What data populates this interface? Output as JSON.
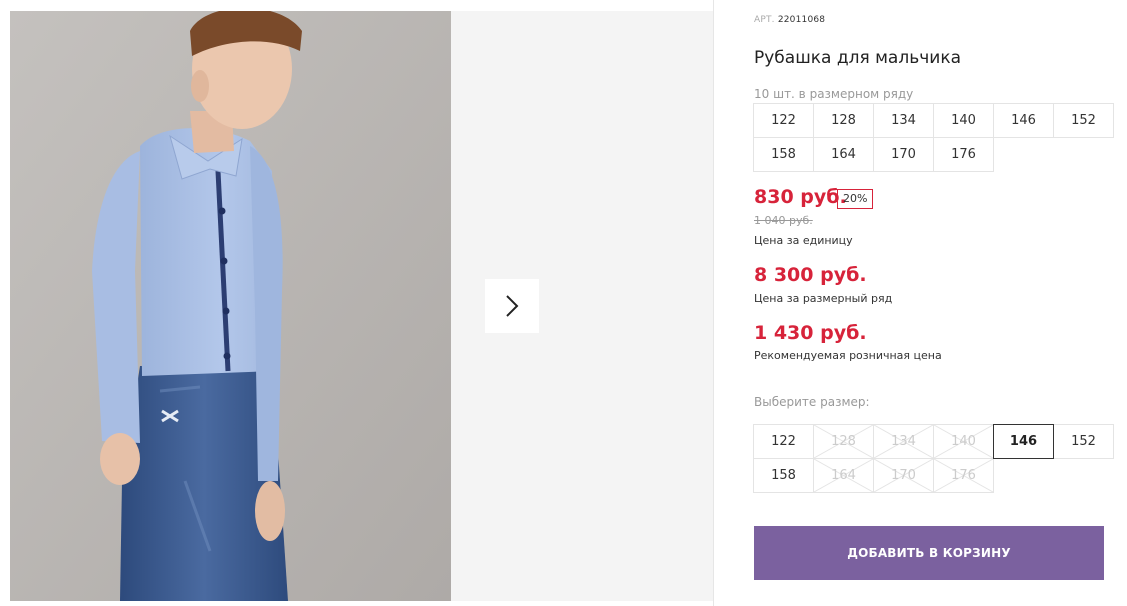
{
  "gallery": {
    "image_alt": "Мальчик в голубой рубашке и джинсах",
    "next_icon": "chevron-right-icon"
  },
  "product": {
    "article_label": "АРТ.",
    "article_value": "22011068",
    "title": "Рубашка для мальчика",
    "pack_text": "10 шт. в размерном ряду",
    "size_range": [
      "122",
      "128",
      "134",
      "140",
      "146",
      "152",
      "158",
      "164",
      "170",
      "176"
    ]
  },
  "prices": {
    "unit_price": "830 руб.",
    "discount": "20%",
    "old_price": "1 040 руб.",
    "unit_label": "Цена за единицу",
    "range_price": "8 300 руб.",
    "range_label": "Цена за размерный ряд",
    "retail_price": "1 430 руб.",
    "retail_label": "Рекомендуемая розничная цена"
  },
  "size_picker": {
    "label": "Выберите размер:",
    "sizes": [
      {
        "value": "122",
        "available": true
      },
      {
        "value": "128",
        "available": false
      },
      {
        "value": "134",
        "available": false
      },
      {
        "value": "140",
        "available": false
      },
      {
        "value": "146",
        "available": true,
        "selected": true
      },
      {
        "value": "152",
        "available": true
      },
      {
        "value": "158",
        "available": true
      },
      {
        "value": "164",
        "available": false
      },
      {
        "value": "170",
        "available": false
      },
      {
        "value": "176",
        "available": false
      }
    ]
  },
  "cart": {
    "button_label": "ДОБАВИТЬ В КОРЗИНУ"
  },
  "colors": {
    "price_red": "#d7233a",
    "button_purple": "#7b619f"
  }
}
